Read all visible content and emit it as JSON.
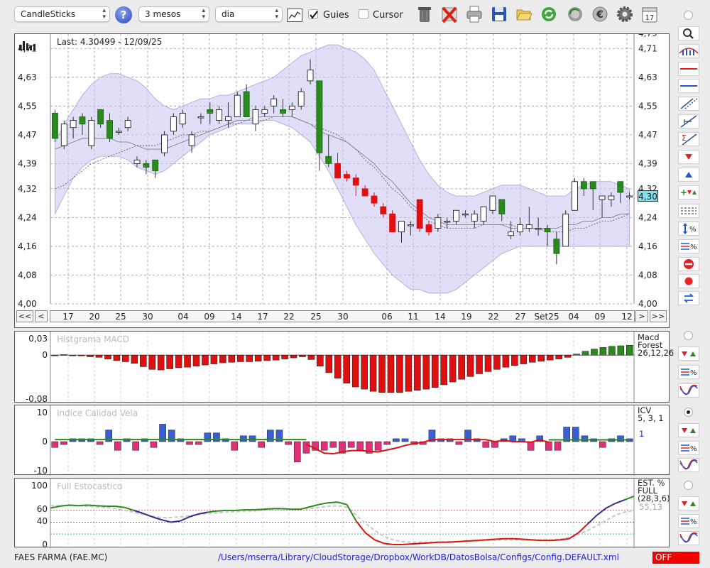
{
  "toolbar": {
    "chart_type": "CandleSticks",
    "period": "3 mesos",
    "interval": "dia",
    "guides_label": "Guies",
    "guides_checked": true,
    "cursor_label": "Cursor",
    "cursor_checked": false,
    "help_glyph": "?",
    "calendar_day": "17",
    "icons": [
      "chart-settings-icon",
      "trash-icon",
      "delete-icon",
      "print-icon",
      "save-icon",
      "open-folder-icon",
      "refresh-icon",
      "globe-refresh-icon",
      "euro-icon",
      "gear-icon",
      "calendar-icon"
    ]
  },
  "main_panel": {
    "last_label": "Last: 4.30499 - 12/09/25",
    "last_value_badge": "4,30",
    "ylim": [
      4.0,
      4.75
    ],
    "y_ticks": [
      "4,00",
      "4,08",
      "4,16",
      "4,24",
      "4,32",
      "4,39",
      "4,47",
      "4,55",
      "4,63",
      "4,71"
    ],
    "top_tick_partial": "4,79",
    "x_tick_labels": [
      "17",
      "20",
      "25",
      "30",
      "04",
      "09",
      "14",
      "17",
      "22",
      "25",
      "30",
      "06",
      "11",
      "14",
      "19",
      "22",
      "27",
      "Set25",
      "04",
      "09",
      "12"
    ],
    "nav": {
      "first": "<<",
      "prev": "<",
      "next": ">",
      "last": ">>"
    }
  },
  "macd_panel": {
    "title": "Histgrama MACD",
    "label_line1": "Macd",
    "label_line2": "Forest",
    "params": "26,12,26",
    "y_ticks": [
      "0,03",
      "0",
      "-0,08"
    ]
  },
  "icv_panel": {
    "title": "Indice Calidad Vela",
    "label": "ICV",
    "params": "5, 3, 1",
    "value": "1",
    "y_ticks": [
      "10",
      "0",
      "-10"
    ]
  },
  "stoch_panel": {
    "title": "Full Estocastico",
    "label_line1": "EST. %",
    "label_line2": "FULL",
    "params": "(28,3,6)",
    "values": "55,13",
    "y_ticks": [
      "100",
      "60",
      "40",
      "0"
    ]
  },
  "footer": {
    "ticker": "FAES FARMA (FAE.MC)",
    "config_path": "/Users/mserra/Library/CloudStorage/Dropbox/WorkDB/DatosBolsa/Configs/Config.DEFAULT.xml",
    "status": "OFF"
  },
  "colors": {
    "up": "#2a8a1e",
    "down": "#e01010",
    "band": "#c9c3f0",
    "macd_pos": "#2a8a1e",
    "macd_neg": "#e01010",
    "icv_pos": "#3a5fd0",
    "icv_neg": "#e0307a",
    "stoch_k": "#2a8a1e",
    "stoch_k_down": "#e01010",
    "stoch_k_mid": "#3a2a8a"
  },
  "chart_data": [
    {
      "type": "candlestick",
      "title": "",
      "ylim": [
        4.0,
        4.75
      ],
      "candles": [
        [
          4.53,
          4.54,
          4.45,
          4.46
        ],
        [
          4.44,
          4.51,
          4.43,
          4.5
        ],
        [
          4.49,
          4.52,
          4.46,
          4.51
        ],
        [
          4.52,
          4.53,
          4.47,
          4.5
        ],
        [
          4.44,
          4.52,
          4.43,
          4.51
        ],
        [
          4.54,
          4.54,
          4.49,
          4.5
        ],
        [
          4.51,
          4.53,
          4.45,
          4.46
        ],
        [
          4.48,
          4.49,
          4.47,
          4.48
        ],
        [
          4.49,
          4.52,
          4.48,
          4.51
        ],
        [
          4.39,
          4.41,
          4.38,
          4.4
        ],
        [
          4.39,
          4.4,
          4.36,
          4.38
        ],
        [
          4.4,
          4.4,
          4.35,
          4.37
        ],
        [
          4.42,
          4.48,
          4.41,
          4.47
        ],
        [
          4.48,
          4.53,
          4.47,
          4.52
        ],
        [
          4.5,
          4.54,
          4.49,
          4.53
        ],
        [
          4.44,
          4.48,
          4.42,
          4.47
        ],
        [
          4.52,
          4.53,
          4.5,
          4.52
        ],
        [
          4.54,
          4.56,
          4.5,
          4.53
        ],
        [
          4.51,
          4.55,
          4.5,
          4.54
        ],
        [
          4.51,
          4.56,
          4.49,
          4.52
        ],
        [
          4.52,
          4.59,
          4.52,
          4.58
        ],
        [
          4.59,
          4.61,
          4.53,
          4.52
        ],
        [
          4.5,
          4.55,
          4.48,
          4.54
        ],
        [
          4.53,
          4.55,
          4.52,
          4.54
        ],
        [
          4.55,
          4.58,
          4.53,
          4.57
        ],
        [
          4.54,
          4.57,
          4.52,
          4.53
        ],
        [
          4.54,
          4.56,
          4.52,
          4.55
        ],
        [
          4.55,
          4.6,
          4.54,
          4.59
        ],
        [
          4.62,
          4.68,
          4.61,
          4.65
        ],
        [
          4.62,
          4.62,
          4.37,
          4.42
        ],
        [
          4.41,
          4.47,
          4.38,
          4.39
        ],
        [
          4.39,
          4.42,
          4.35,
          4.35
        ],
        [
          4.36,
          4.37,
          4.34,
          4.35
        ],
        [
          4.35,
          4.36,
          4.3,
          4.33
        ],
        [
          4.32,
          4.33,
          4.3,
          4.3
        ],
        [
          4.3,
          4.31,
          4.27,
          4.28
        ],
        [
          4.27,
          4.28,
          4.24,
          4.25
        ],
        [
          4.25,
          4.26,
          4.2,
          4.2
        ],
        [
          4.2,
          4.22,
          4.17,
          4.23
        ],
        [
          4.22,
          4.23,
          4.19,
          4.22
        ],
        [
          4.29,
          4.29,
          4.2,
          4.21
        ],
        [
          4.22,
          4.23,
          4.19,
          4.2
        ],
        [
          4.21,
          4.25,
          4.2,
          4.24
        ],
        [
          4.23,
          4.24,
          4.21,
          4.23
        ],
        [
          4.23,
          4.26,
          4.22,
          4.26
        ],
        [
          4.25,
          4.26,
          4.24,
          4.25
        ],
        [
          4.23,
          4.26,
          4.21,
          4.25
        ],
        [
          4.23,
          4.27,
          4.22,
          4.27
        ],
        [
          4.26,
          4.3,
          4.25,
          4.3
        ],
        [
          4.29,
          4.29,
          4.23,
          4.25
        ],
        [
          4.19,
          4.23,
          4.18,
          4.2
        ],
        [
          4.2,
          4.24,
          4.19,
          4.22
        ],
        [
          4.21,
          4.27,
          4.2,
          4.22
        ],
        [
          4.21,
          4.24,
          4.19,
          4.21
        ],
        [
          4.21,
          4.22,
          4.16,
          4.2
        ],
        [
          4.18,
          4.2,
          4.11,
          4.14
        ],
        [
          4.16,
          4.26,
          4.16,
          4.25
        ],
        [
          4.26,
          4.35,
          4.26,
          4.34
        ],
        [
          4.34,
          4.35,
          4.3,
          4.32
        ],
        [
          4.34,
          4.34,
          4.26,
          4.32
        ],
        [
          4.29,
          4.3,
          4.24,
          4.3
        ],
        [
          4.29,
          4.31,
          4.27,
          4.3
        ],
        [
          4.34,
          4.34,
          4.28,
          4.31
        ],
        [
          4.3,
          4.31,
          4.29,
          4.3
        ]
      ],
      "upper_band": [
        4.45,
        4.5,
        4.54,
        4.58,
        4.61,
        4.63,
        4.64,
        4.64,
        4.63,
        4.62,
        4.6,
        4.57,
        4.55,
        4.54,
        4.55,
        4.56,
        4.57,
        4.57,
        4.58,
        4.58,
        4.59,
        4.6,
        4.61,
        4.62,
        4.63,
        4.65,
        4.67,
        4.69,
        4.7,
        4.71,
        4.72,
        4.72,
        4.71,
        4.7,
        4.68,
        4.65,
        4.6,
        4.55,
        4.5,
        4.45,
        4.4,
        4.36,
        4.33,
        4.31,
        4.3,
        4.3,
        4.3,
        4.31,
        4.32,
        4.33,
        4.33,
        4.33,
        4.32,
        4.31,
        4.3,
        4.3,
        4.3,
        4.32,
        4.33,
        4.34,
        4.34,
        4.34,
        4.33,
        4.32
      ],
      "lower_band": [
        4.25,
        4.3,
        4.35,
        4.38,
        4.4,
        4.41,
        4.41,
        4.41,
        4.4,
        4.38,
        4.37,
        4.36,
        4.37,
        4.39,
        4.41,
        4.43,
        4.45,
        4.47,
        4.48,
        4.49,
        4.5,
        4.5,
        4.5,
        4.51,
        4.51,
        4.5,
        4.49,
        4.47,
        4.45,
        4.41,
        4.37,
        4.32,
        4.27,
        4.22,
        4.18,
        4.14,
        4.11,
        4.08,
        4.06,
        4.04,
        4.04,
        4.03,
        4.03,
        4.03,
        4.04,
        4.06,
        4.08,
        4.1,
        4.12,
        4.14,
        4.15,
        4.16,
        4.16,
        4.16,
        4.16,
        4.16,
        4.16,
        4.16,
        4.16,
        4.16,
        4.16,
        4.16,
        4.16,
        4.16
      ],
      "ma": [
        4.32,
        4.33,
        4.35,
        4.37,
        4.39,
        4.4,
        4.41,
        4.42,
        4.43,
        4.44,
        4.44,
        4.44,
        4.45,
        4.46,
        4.47,
        4.47,
        4.48,
        4.48,
        4.49,
        4.5,
        4.5,
        4.51,
        4.51,
        4.51,
        4.52,
        4.52,
        4.52,
        4.51,
        4.5,
        4.49,
        4.48,
        4.47,
        4.45,
        4.43,
        4.4,
        4.38,
        4.35,
        4.32,
        4.3,
        4.27,
        4.25,
        4.23,
        4.22,
        4.21,
        4.21,
        4.21,
        4.21,
        4.22,
        4.22,
        4.22,
        4.22,
        4.21,
        4.21,
        4.21,
        4.2,
        4.2,
        4.2,
        4.21,
        4.21,
        4.22,
        4.23,
        4.23,
        4.24,
        4.25
      ],
      "ma2": [
        4.43,
        4.44,
        4.45,
        4.46,
        4.46,
        4.46,
        4.46,
        4.45,
        4.45,
        4.44,
        4.43,
        4.43,
        4.43,
        4.44,
        4.45,
        4.46,
        4.47,
        4.48,
        4.49,
        4.5,
        4.51,
        4.51,
        4.52,
        4.52,
        4.52,
        4.52,
        4.52,
        4.51,
        4.5,
        4.48,
        4.47,
        4.46,
        4.45,
        4.43,
        4.41,
        4.39,
        4.36,
        4.34,
        4.31,
        4.28,
        4.26,
        4.24,
        4.23,
        4.22,
        4.22,
        4.22,
        4.22,
        4.22,
        4.22,
        4.22,
        4.21,
        4.21,
        4.21,
        4.21,
        4.21,
        4.21,
        4.22,
        4.22,
        4.23,
        4.23,
        4.24,
        4.24,
        4.25,
        4.25
      ]
    },
    {
      "type": "bar",
      "title": "Histgrama MACD",
      "ylim": [
        -0.08,
        0.03
      ],
      "values": [
        0.0,
        0.001,
        0.0,
        -0.001,
        -0.003,
        -0.004,
        -0.007,
        -0.01,
        -0.012,
        -0.015,
        -0.021,
        -0.026,
        -0.027,
        -0.025,
        -0.023,
        -0.022,
        -0.02,
        -0.018,
        -0.016,
        -0.014,
        -0.013,
        -0.012,
        -0.012,
        -0.011,
        -0.01,
        -0.009,
        -0.007,
        -0.005,
        -0.003,
        -0.008,
        -0.02,
        -0.032,
        -0.042,
        -0.051,
        -0.058,
        -0.062,
        -0.066,
        -0.068,
        -0.068,
        -0.068,
        -0.066,
        -0.064,
        -0.062,
        -0.059,
        -0.054,
        -0.049,
        -0.044,
        -0.039,
        -0.034,
        -0.03,
        -0.026,
        -0.022,
        -0.019,
        -0.016,
        -0.013,
        -0.011,
        -0.009,
        -0.007,
        -0.004,
        0.002,
        0.007,
        0.011,
        0.014,
        0.016,
        0.017,
        0.018
      ]
    },
    {
      "type": "bar",
      "title": "Indice Calidad Vela",
      "ylim": [
        -10,
        10
      ],
      "values": [
        -2,
        -1,
        1,
        1,
        1,
        -1,
        4,
        -3,
        1,
        -3,
        1,
        -2,
        6,
        4,
        1,
        -1,
        -1,
        3,
        3,
        1,
        -3,
        2,
        2,
        -2,
        4,
        4,
        -1,
        -7,
        -4,
        -3,
        -3,
        -2,
        -4,
        -2,
        -3,
        -4,
        -3,
        -1,
        1,
        1,
        -1,
        -1,
        4,
        1,
        1,
        -1,
        4,
        1,
        -2,
        -2,
        1,
        2,
        1,
        -3,
        2,
        -3,
        -3,
        5,
        5,
        2,
        1,
        -2,
        1,
        2,
        1
      ]
    },
    {
      "type": "line",
      "title": "Full Estocastico",
      "ylim": [
        0,
        100
      ],
      "k": [
        62,
        65,
        67,
        66,
        67,
        66,
        65,
        65,
        63,
        58,
        53,
        47,
        42,
        38,
        40,
        47,
        52,
        55,
        57,
        58,
        58,
        59,
        59,
        60,
        61,
        61,
        60,
        60,
        64,
        68,
        71,
        72,
        68,
        40,
        20,
        8,
        2,
        0,
        0,
        1,
        2,
        3,
        4,
        4,
        5,
        6,
        7,
        8,
        9,
        10,
        10,
        9,
        8,
        7,
        7,
        8,
        10,
        20,
        35,
        50,
        62,
        70,
        76,
        82
      ],
      "d": [
        66,
        66,
        66,
        66,
        65,
        64,
        63,
        61,
        58,
        55,
        51,
        48,
        46,
        46,
        47,
        49,
        51,
        53,
        54,
        55,
        56,
        57,
        57,
        58,
        59,
        59,
        59,
        60,
        61,
        63,
        65,
        66,
        63,
        50,
        36,
        24,
        14,
        8,
        5,
        4,
        4,
        4,
        4,
        5,
        5,
        6,
        6,
        7,
        8,
        8,
        8,
        8,
        8,
        8,
        8,
        9,
        12,
        17,
        24,
        32,
        41,
        50,
        55,
        58
      ],
      "ref_lines": [
        80,
        60,
        40
      ]
    }
  ]
}
